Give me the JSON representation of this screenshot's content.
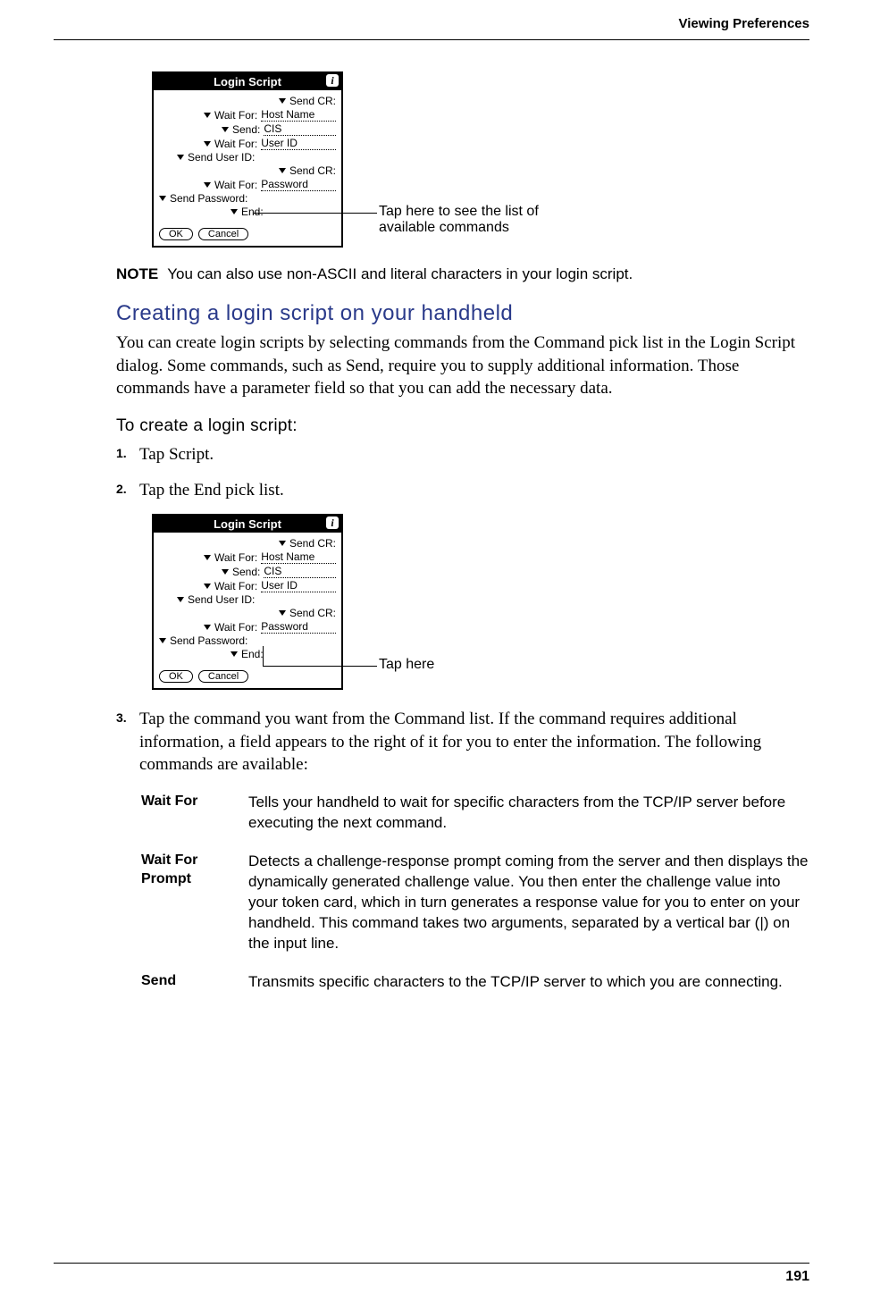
{
  "header": "Viewing Preferences",
  "page_number": "191",
  "palm_dialog": {
    "title": "Login Script",
    "info_glyph": "i",
    "rows": [
      {
        "label": "Send CR:",
        "value": ""
      },
      {
        "label": "Wait For:",
        "value": "Host Name"
      },
      {
        "label": "Send:",
        "value": "CIS"
      },
      {
        "label": "Wait For:",
        "value": "User ID"
      },
      {
        "label": "Send User ID:",
        "value": ""
      },
      {
        "label": "Send CR:",
        "value": ""
      },
      {
        "label": "Wait For:",
        "value": "Password"
      },
      {
        "label": "Send Password:",
        "value": ""
      },
      {
        "label": "End:",
        "value": ""
      }
    ],
    "ok": "OK",
    "cancel": "Cancel"
  },
  "callout1": "Tap here to see the list of available commands",
  "callout2": "Tap here",
  "note_label": "NOTE",
  "note_text": "You can also use non-ASCII and literal characters in your login script.",
  "section_heading": "Creating a login script on your handheld",
  "section_body": "You can create login scripts by selecting commands from the Command pick list in the Login Script dialog. Some commands, such as Send, require you to supply additional information. Those commands have a parameter field so that you can add the necessary data.",
  "sub_heading": "To create a login script:",
  "steps": [
    {
      "num": "1.",
      "text": "Tap Script."
    },
    {
      "num": "2.",
      "text": "Tap the End pick list."
    },
    {
      "num": "3.",
      "text": "Tap the command you want from the Command list. If the command requires additional information, a field appears to the right of it for you to enter the information. The following commands are available:"
    }
  ],
  "commands": [
    {
      "name": "Wait For",
      "desc": "Tells your handheld to wait for specific characters from the TCP/IP server before executing the next command."
    },
    {
      "name": "Wait For Prompt",
      "desc": "Detects a challenge-response prompt coming from the server and then displays the dynamically generated challenge value. You then enter the challenge value into your token card, which in turn generates a response value for you to enter on your handheld. This command takes two arguments, separated by a vertical bar (|) on the input line."
    },
    {
      "name": "Send",
      "desc": "Transmits specific characters to the TCP/IP server to which you are connecting."
    }
  ]
}
